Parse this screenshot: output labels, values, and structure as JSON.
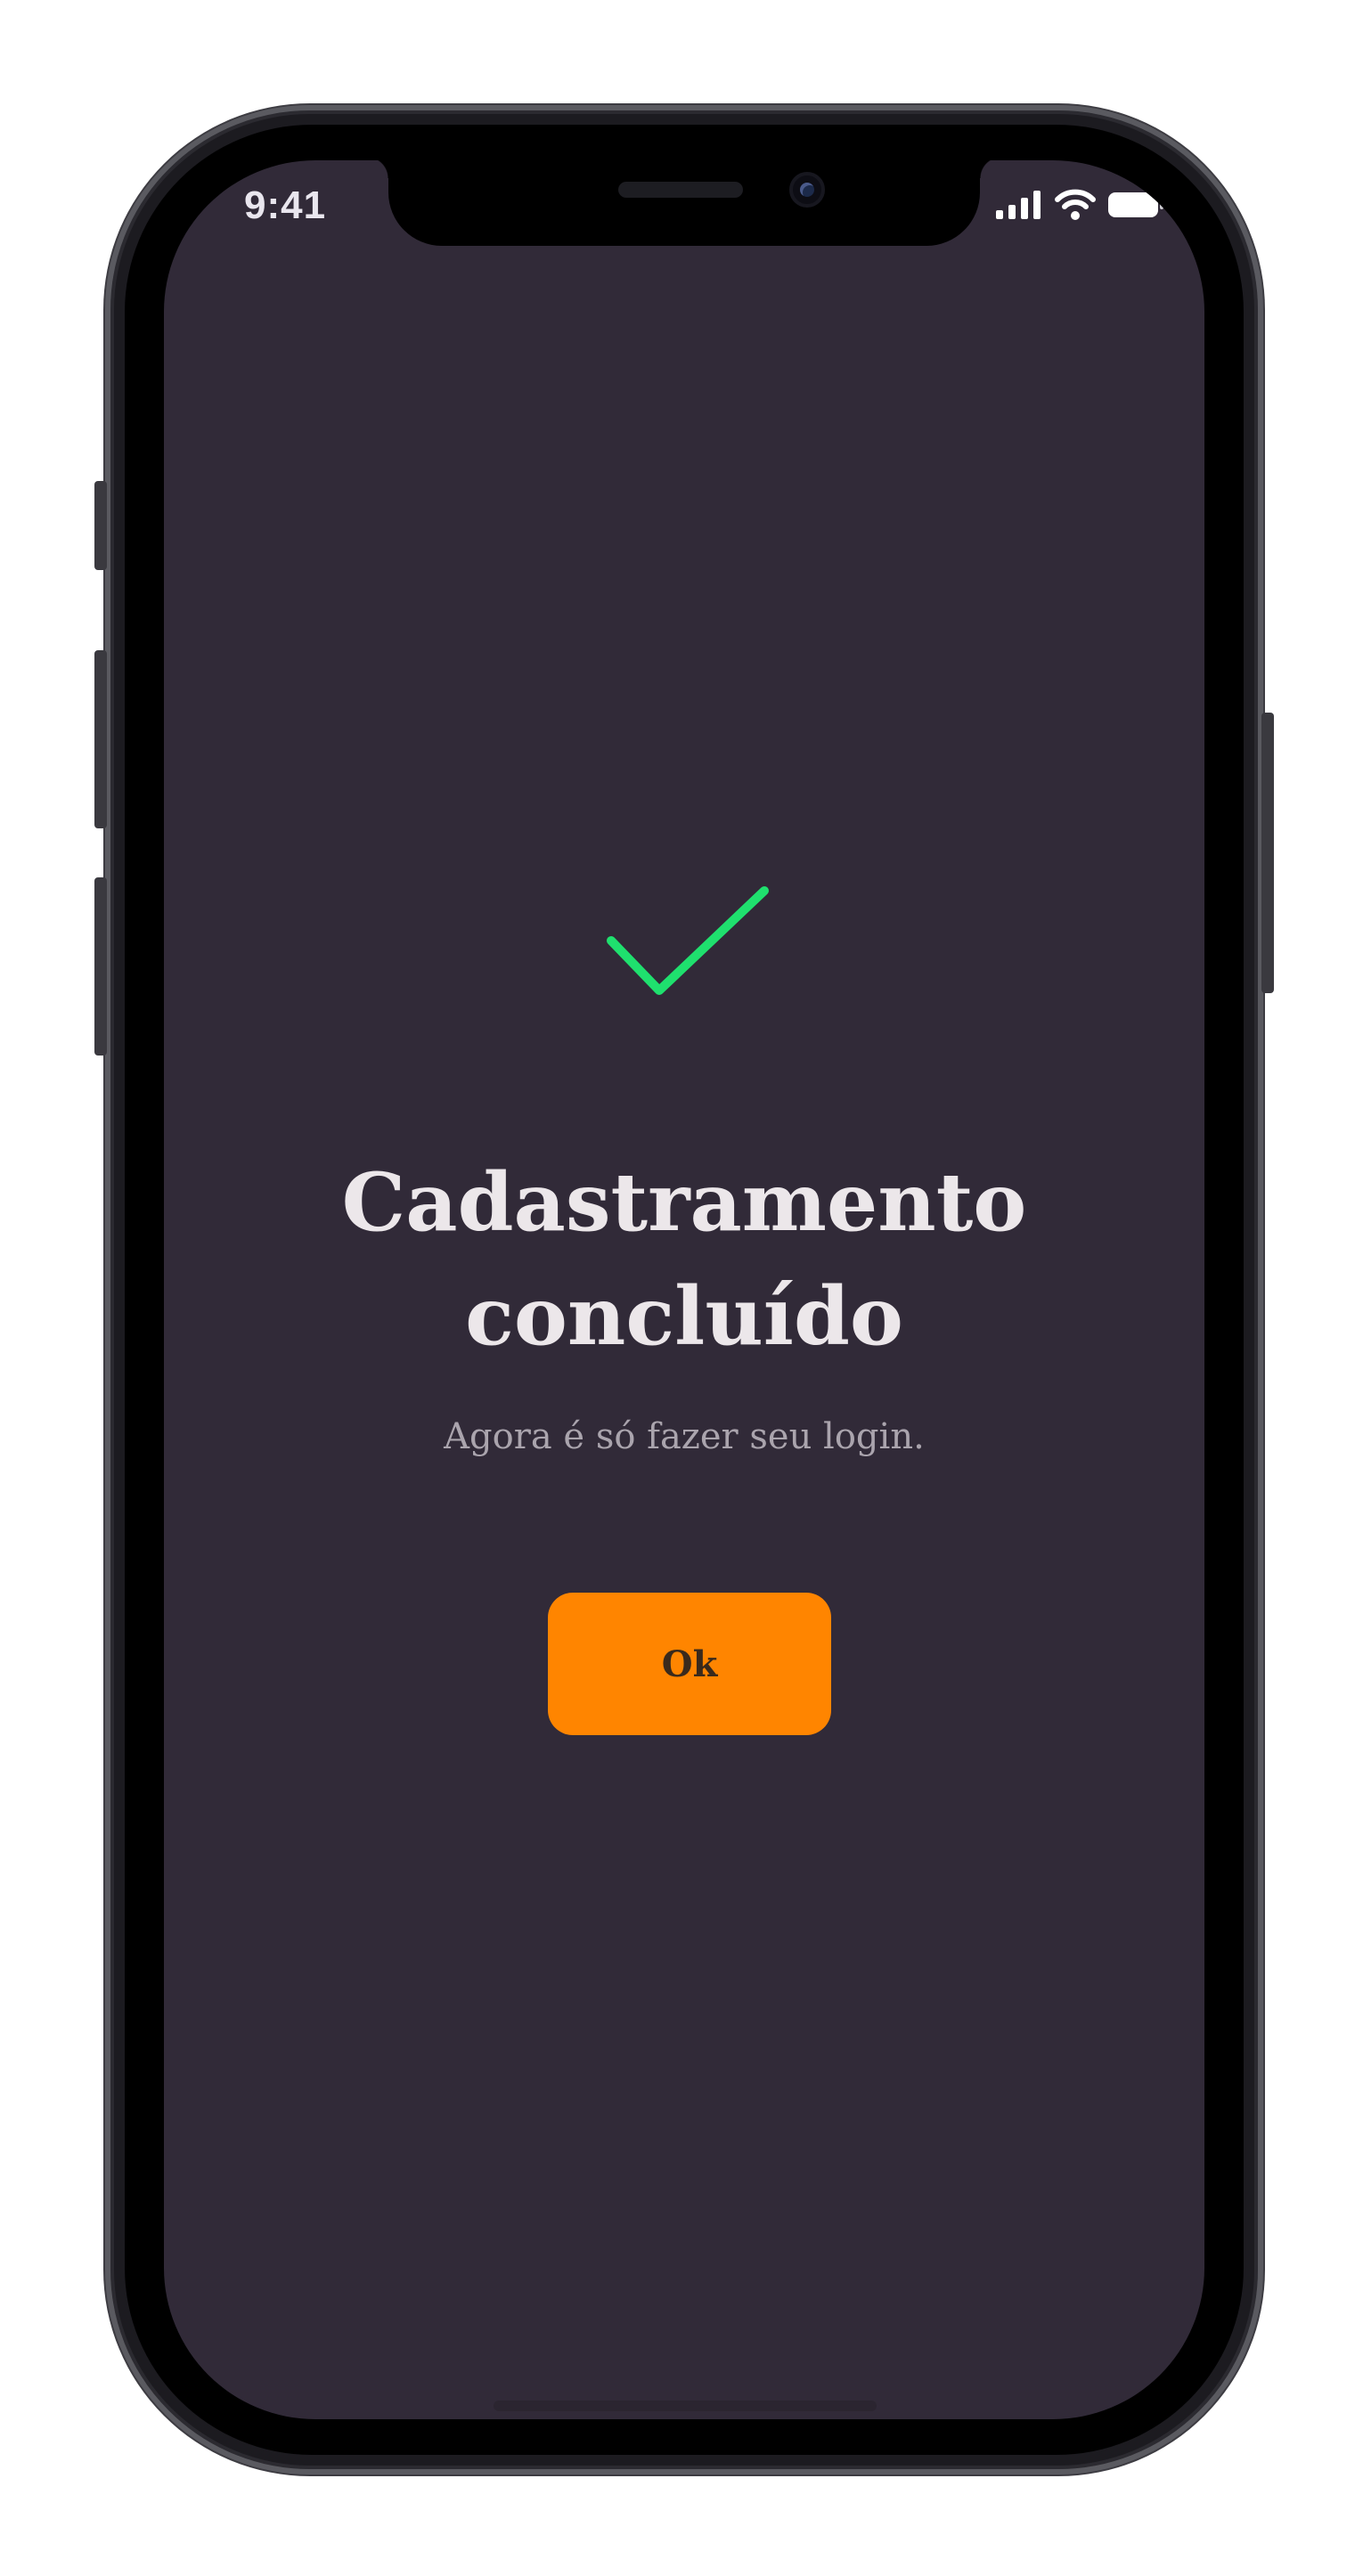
{
  "status_bar": {
    "time": "9:41",
    "icons": [
      "cellular-signal-icon",
      "wifi-icon",
      "battery-icon"
    ]
  },
  "success": {
    "icon": "checkmark-icon",
    "icon_color": "#1fe06e",
    "title_line_1": "Cadastramento",
    "title_line_2": "concluído",
    "subtitle": "Agora é só fazer seu login."
  },
  "actions": {
    "ok_label": "Ok",
    "ok_color": "#ff8500"
  },
  "theme": {
    "background": "#312a38"
  }
}
